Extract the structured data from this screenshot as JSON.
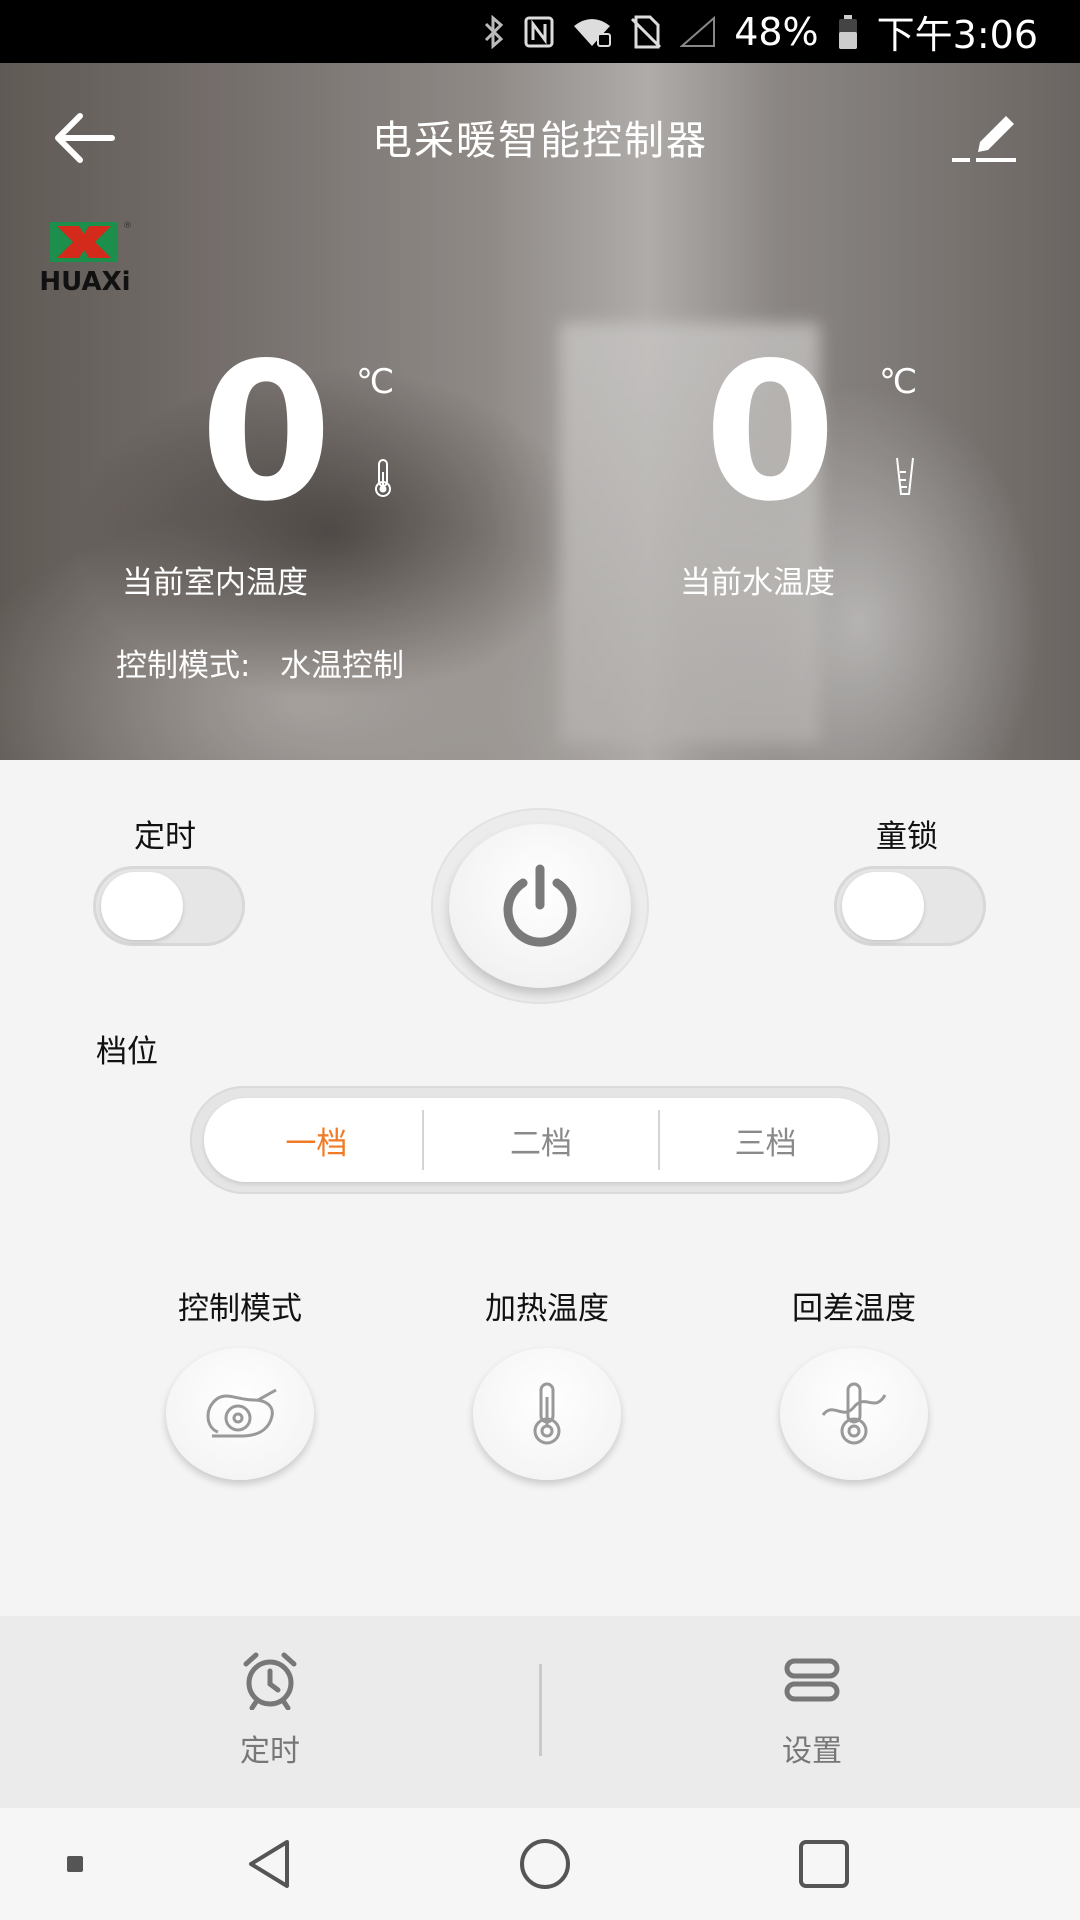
{
  "status_bar": {
    "battery_percent": "48%",
    "time": "下午3:06",
    "icons": [
      "bluetooth-icon",
      "nfc-icon",
      "wifi-icon",
      "no-sim-icon",
      "signal-icon",
      "battery-icon"
    ]
  },
  "header": {
    "title": "电采暖智能控制器",
    "back_icon": "back-arrow-icon",
    "edit_icon": "edit-pencil-icon"
  },
  "logo": {
    "text": "HUAXi"
  },
  "readings": {
    "indoor": {
      "value": "0",
      "unit": "℃",
      "label": "当前室内温度",
      "icon": "thermometer-icon"
    },
    "water": {
      "value": "0",
      "unit": "℃",
      "label": "当前水温度",
      "icon": "water-cup-icon"
    }
  },
  "control_mode": {
    "label": "控制模式:",
    "value": "水温控制"
  },
  "timer_toggle": {
    "label": "定时",
    "on": false
  },
  "child_lock_toggle": {
    "label": "童锁",
    "on": false
  },
  "power": {
    "icon": "power-icon"
  },
  "gear": {
    "label": "档位",
    "options": [
      "一档",
      "二档",
      "三档"
    ],
    "selected": "一档",
    "active_color": "#f07a25"
  },
  "functions": [
    {
      "label": "控制模式",
      "icon": "mode-icon"
    },
    {
      "label": "加热温度",
      "icon": "thermometer-icon"
    },
    {
      "label": "回差温度",
      "icon": "hysteresis-thermometer-icon"
    }
  ],
  "bottom_tabs": [
    {
      "label": "定时",
      "icon": "alarm-clock-icon"
    },
    {
      "label": "设置",
      "icon": "settings-icon"
    }
  ],
  "nav_bar": [
    "recent-dot-icon",
    "back-triangle-icon",
    "home-circle-icon",
    "overview-square-icon"
  ]
}
